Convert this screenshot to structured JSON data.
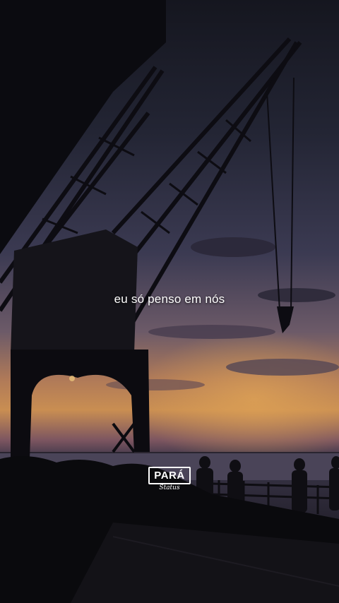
{
  "video": {
    "caption": "eu só penso em nós"
  },
  "logo": {
    "title": "PARÁ",
    "subtitle": "Status"
  },
  "colors": {
    "sky_top": "#1f2234",
    "sky_mid": "#3e3a52",
    "sunset_orange": "#d79a4a",
    "sunset_pink": "#9a5a55",
    "water": "#4a4458",
    "silhouette": "#0c0b10"
  }
}
